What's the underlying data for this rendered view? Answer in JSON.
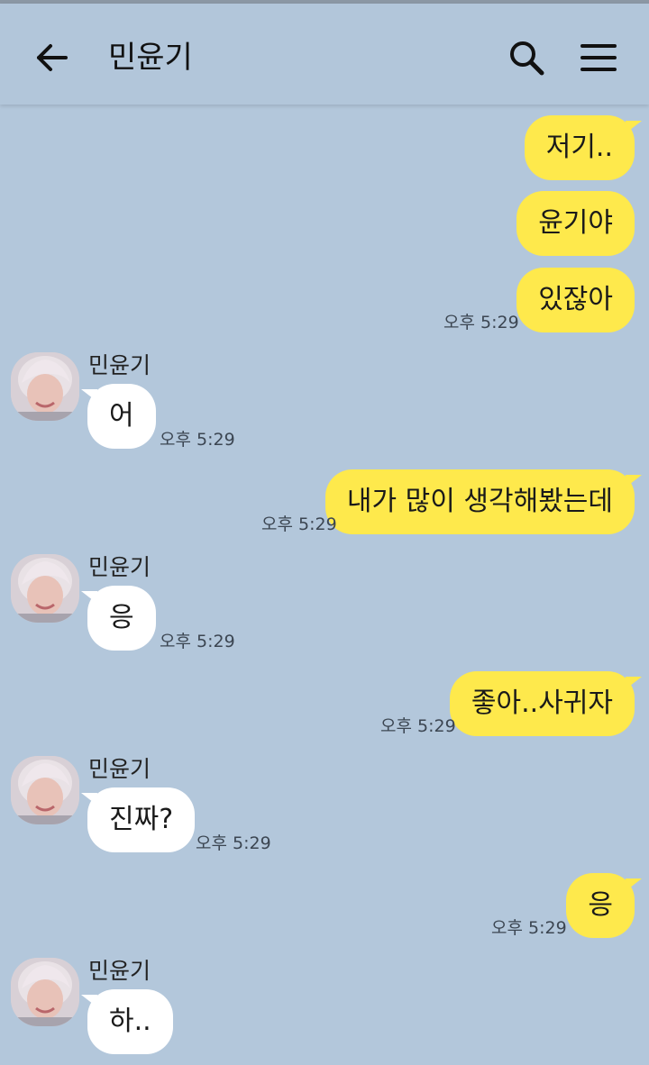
{
  "header": {
    "title": "민윤기",
    "back_icon": "arrow-left-icon",
    "search_icon": "search-icon",
    "menu_icon": "hamburger-menu-icon"
  },
  "colors": {
    "background": "#b3c7db",
    "my_bubble": "#fee94c",
    "their_bubble": "#ffffff"
  },
  "messages": [
    {
      "text": "저기.."
    },
    {
      "text": "윤기야"
    },
    {
      "text": "있잖아",
      "time": "오후 5:29"
    },
    {
      "sender": "민윤기",
      "text": "어",
      "time": "오후 5:29"
    },
    {
      "text": "내가 많이 생각해봤는데",
      "time": "오후 5:29"
    },
    {
      "sender": "민윤기",
      "text": "응",
      "time": "오후 5:29"
    },
    {
      "text": "좋아..사귀자",
      "time": "오후 5:29"
    },
    {
      "sender": "민윤기",
      "text": "진짜?",
      "time": "오후 5:29"
    },
    {
      "text": "응",
      "time": "오후 5:29"
    },
    {
      "sender": "민윤기",
      "text": "하.."
    }
  ]
}
